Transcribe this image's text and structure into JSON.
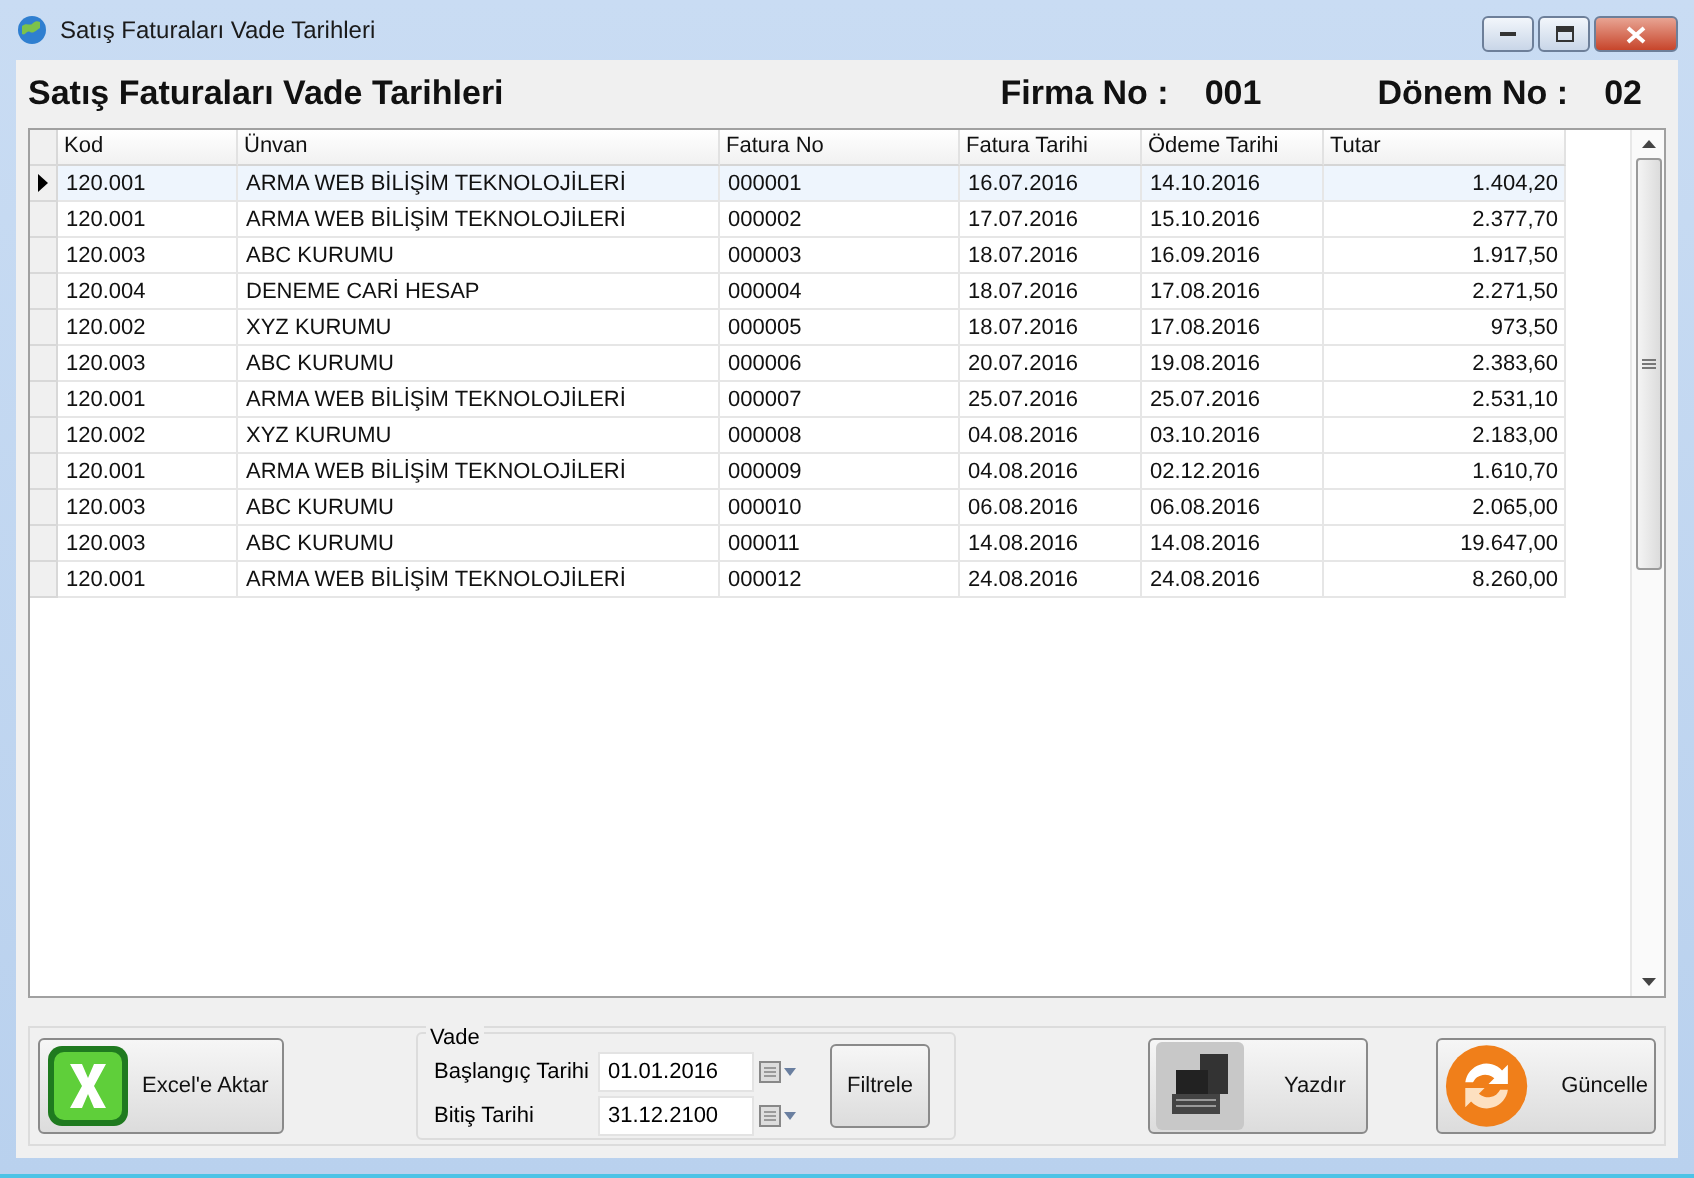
{
  "window": {
    "title": "Satış Faturaları Vade Tarihleri"
  },
  "header": {
    "title": "Satış Faturaları Vade Tarihleri",
    "firma_label": "Firma No :",
    "firma_value": "001",
    "donem_label": "Dönem No :",
    "donem_value": "02"
  },
  "table": {
    "columns": [
      "Kod",
      "Ünvan",
      "Fatura No",
      "Fatura Tarihi",
      "Ödeme Tarihi",
      "Tutar"
    ],
    "rows": [
      {
        "selected": true,
        "cells": [
          "120.001",
          "ARMA WEB BİLİŞİM TEKNOLOJİLERİ",
          "000001",
          "16.07.2016",
          "14.10.2016",
          "1.404,20"
        ]
      },
      {
        "selected": false,
        "cells": [
          "120.001",
          "ARMA WEB BİLİŞİM TEKNOLOJİLERİ",
          "000002",
          "17.07.2016",
          "15.10.2016",
          "2.377,70"
        ]
      },
      {
        "selected": false,
        "cells": [
          "120.003",
          "ABC KURUMU",
          "000003",
          "18.07.2016",
          "16.09.2016",
          "1.917,50"
        ]
      },
      {
        "selected": false,
        "cells": [
          "120.004",
          "DENEME CARİ HESAP",
          "000004",
          "18.07.2016",
          "17.08.2016",
          "2.271,50"
        ]
      },
      {
        "selected": false,
        "cells": [
          "120.002",
          "XYZ KURUMU",
          "000005",
          "18.07.2016",
          "17.08.2016",
          "973,50"
        ]
      },
      {
        "selected": false,
        "cells": [
          "120.003",
          "ABC KURUMU",
          "000006",
          "20.07.2016",
          "19.08.2016",
          "2.383,60"
        ]
      },
      {
        "selected": false,
        "cells": [
          "120.001",
          "ARMA WEB BİLİŞİM TEKNOLOJİLERİ",
          "000007",
          "25.07.2016",
          "25.07.2016",
          "2.531,10"
        ]
      },
      {
        "selected": false,
        "cells": [
          "120.002",
          "XYZ KURUMU",
          "000008",
          "04.08.2016",
          "03.10.2016",
          "2.183,00"
        ]
      },
      {
        "selected": false,
        "cells": [
          "120.001",
          "ARMA WEB BİLİŞİM TEKNOLOJİLERİ",
          "000009",
          "04.08.2016",
          "02.12.2016",
          "1.610,70"
        ]
      },
      {
        "selected": false,
        "cells": [
          "120.003",
          "ABC KURUMU",
          "000010",
          "06.08.2016",
          "06.08.2016",
          "2.065,00"
        ]
      },
      {
        "selected": false,
        "cells": [
          "120.003",
          "ABC KURUMU",
          "000011",
          "14.08.2016",
          "14.08.2016",
          "19.647,00"
        ]
      },
      {
        "selected": false,
        "cells": [
          "120.001",
          "ARMA WEB BİLİŞİM TEKNOLOJİLERİ",
          "000012",
          "24.08.2016",
          "24.08.2016",
          "8.260,00"
        ]
      }
    ]
  },
  "footer": {
    "excel_button": "Excel'e Aktar",
    "vade": {
      "title": "Vade",
      "fields": [
        {
          "label": "Başlangıç Tarihi",
          "value": "01.01.2016"
        },
        {
          "label": "Bitiş Tarihi",
          "value": "31.12.2100"
        }
      ],
      "filter_button": "Filtrele"
    },
    "print_button": "Yazdır",
    "refresh_button": "Güncelle"
  }
}
